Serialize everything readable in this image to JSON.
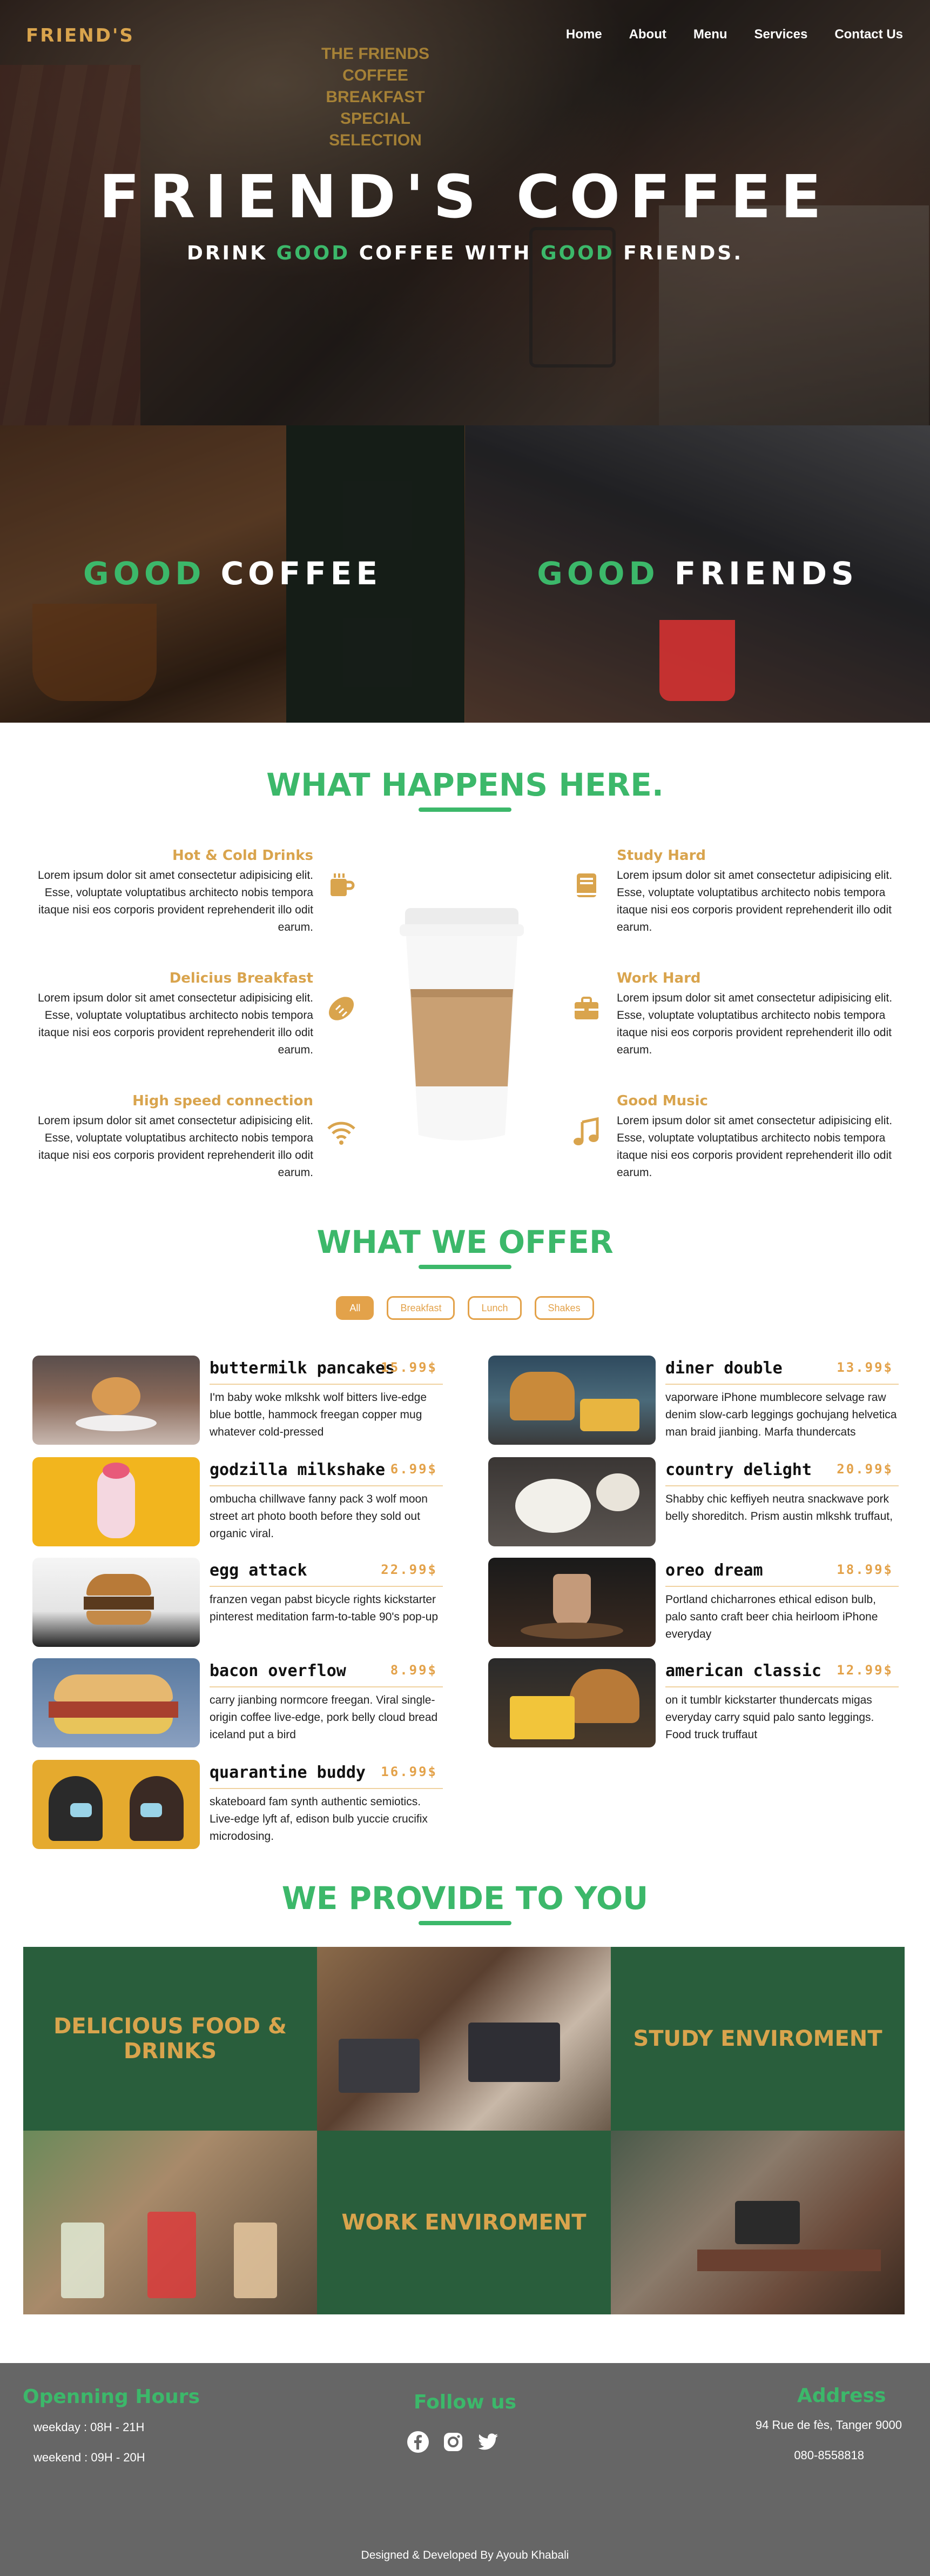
{
  "nav": {
    "brand": "FRIEND'S",
    "links": [
      "Home",
      "About",
      "Menu",
      "Services",
      "Contact Us"
    ]
  },
  "hero": {
    "title": "FRIEND'S COFFEE",
    "sub_pre": "DRINK ",
    "sub_good1": "GOOD",
    "sub_mid": " COFFEE WITH ",
    "sub_good2": "GOOD",
    "sub_post": " FRIENDS."
  },
  "panels": {
    "left_good": "GOOD",
    "left_word": " COFFEE",
    "right_good": "GOOD",
    "right_word": " FRIENDS",
    "board_text": "THE FRIENDS COFFEE BREAKFAST SPECIAL SELECTION"
  },
  "happens": {
    "title": "WHAT HAPPENS HERE.",
    "features": [
      {
        "title": "Hot & Cold Drinks",
        "icon": "cup-icon",
        "text": "Lorem ipsum dolor sit amet consectetur adipisicing elit. Esse, voluptate voluptatibus architecto nobis tempora itaque nisi eos corporis provident reprehenderit illo odit earum."
      },
      {
        "title": "Delicius Breakfast",
        "icon": "bread-icon",
        "text": "Lorem ipsum dolor sit amet consectetur adipisicing elit. Esse, voluptate voluptatibus architecto nobis tempora itaque nisi eos corporis provident reprehenderit illo odit earum."
      },
      {
        "title": "High speed connection",
        "icon": "wifi-icon",
        "text": "Lorem ipsum dolor sit amet consectetur adipisicing elit. Esse, voluptate voluptatibus architecto nobis tempora itaque nisi eos corporis provident reprehenderit illo odit earum."
      },
      {
        "title": "Study Hard",
        "icon": "book-icon",
        "text": "Lorem ipsum dolor sit amet consectetur adipisicing elit. Esse, voluptate voluptatibus architecto nobis tempora itaque nisi eos corporis provident reprehenderit illo odit earum."
      },
      {
        "title": "Work Hard",
        "icon": "briefcase-icon",
        "text": "Lorem ipsum dolor sit amet consectetur adipisicing elit. Esse, voluptate voluptatibus architecto nobis tempora itaque nisi eos corporis provident reprehenderit illo odit earum."
      },
      {
        "title": "Good Music",
        "icon": "music-icon",
        "text": "Lorem ipsum dolor sit amet consectetur adipisicing elit. Esse, voluptate voluptatibus architecto nobis tempora itaque nisi eos corporis provident reprehenderit illo odit earum."
      }
    ]
  },
  "offer": {
    "title": "WHAT WE OFFER",
    "filters": [
      "All",
      "Breakfast",
      "Lunch",
      "Shakes"
    ],
    "active_filter": "All",
    "items": [
      {
        "name": "buttermilk pancakes",
        "price": "15.99$",
        "desc": "I'm baby woke mlkshk wolf bitters live-edge blue bottle, hammock freegan copper mug whatever cold-pressed"
      },
      {
        "name": "diner double",
        "price": "13.99$",
        "desc": "vaporware iPhone mumblecore selvage raw denim slow-carb leggings gochujang helvetica man braid jianbing. Marfa thundercats"
      },
      {
        "name": "godzilla milkshake",
        "price": "6.99$",
        "desc": "ombucha chillwave fanny pack 3 wolf moon street art photo booth before they sold out organic viral."
      },
      {
        "name": "country delight",
        "price": "20.99$",
        "desc": "Shabby chic keffiyeh neutra snackwave pork belly shoreditch. Prism austin mlkshk truffaut,"
      },
      {
        "name": "egg attack",
        "price": "22.99$",
        "desc": "franzen vegan pabst bicycle rights kickstarter pinterest meditation farm-to-table 90's pop-up"
      },
      {
        "name": "oreo dream",
        "price": "18.99$",
        "desc": "Portland chicharrones ethical edison bulb, palo santo craft beer chia heirloom iPhone everyday"
      },
      {
        "name": "bacon overflow",
        "price": "8.99$",
        "desc": "carry jianbing normcore freegan. Viral single-origin coffee live-edge, pork belly cloud bread iceland put a bird"
      },
      {
        "name": "american classic",
        "price": "12.99$",
        "desc": "on it tumblr kickstarter thundercats migas everyday carry squid palo santo leggings. Food truck truffaut"
      },
      {
        "name": "quarantine buddy",
        "price": "16.99$",
        "desc": "skateboard fam synth authentic semiotics. Live-edge lyft af, edison bulb yuccie crucifix microdosing."
      }
    ]
  },
  "provide": {
    "title": "WE PROVIDE TO YOU",
    "tiles": [
      "DELICIOUS FOOD & DRINKS",
      "STUDY ENVIROMENT",
      "WORK ENVIROMENT"
    ]
  },
  "footer": {
    "hours_title": "Openning Hours",
    "weekday": "weekday : 08H - 21H",
    "weekend": "weekend : 09H - 20H",
    "follow_title": "Follow us",
    "social": [
      "facebook-icon",
      "instagram-icon",
      "twitter-icon"
    ],
    "address_title": "Address",
    "address": "94 Rue de fès, Tanger 9000",
    "phone": "080-8558818",
    "credit": "Designed & Developed By Ayoub Khabali"
  },
  "colors": {
    "accent_green": "#3cb86a",
    "accent_gold": "#d9a44d",
    "tile_green": "#295e3c",
    "footer_bg": "#666666"
  }
}
